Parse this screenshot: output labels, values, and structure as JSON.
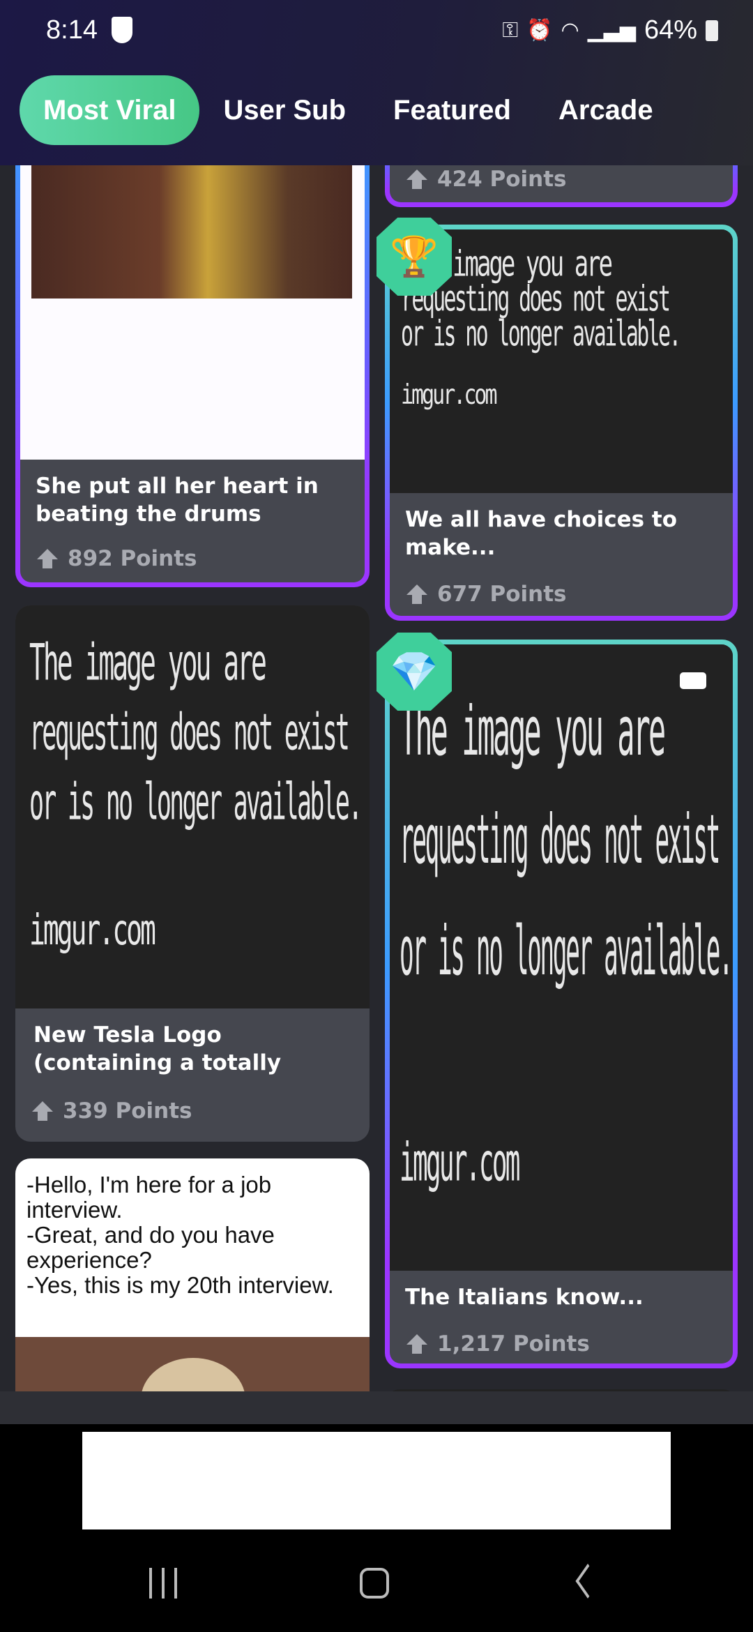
{
  "status_bar": {
    "time": "8:14",
    "battery": "64%",
    "icons": [
      "shield-icon",
      "key-icon",
      "alarm-icon",
      "wifi-icon",
      "signal-icon",
      "battery-icon"
    ]
  },
  "tabs": [
    {
      "label": "Most Viral",
      "active": true
    },
    {
      "label": "User Sub"
    },
    {
      "label": "Featured"
    },
    {
      "label": "Arcade"
    }
  ],
  "placeholder": {
    "l1": "The image you are",
    "l2": "requesting does not exist",
    "l3": "or is no longer available.",
    "l4": "imgur.com",
    "l1_partial": "image you are"
  },
  "posts": [
    {
      "title": "She put all her heart in beating the drums",
      "points": "892 Points"
    },
    {
      "title": "New Tesla Logo (containing a totally",
      "points": "339 Points"
    },
    {
      "caption": [
        "-Hello, I'm here for a job",
        "interview.",
        "-Great, and do you have",
        "experience?",
        "-Yes, this is my 20th interview."
      ]
    },
    {
      "points": "424 Points"
    },
    {
      "title": "We all have choices to make...",
      "points": "677 Points",
      "badge": "trophy-icon"
    },
    {
      "title": "The Italians know...",
      "points": "1,217 Points",
      "badge": "diamond-icon",
      "video": true
    }
  ],
  "colors": {
    "accent": "#4fcf94",
    "border_purple": "#9b35ff",
    "border_teal": "#5ed5c8",
    "border_blue": "#3c9bff"
  }
}
